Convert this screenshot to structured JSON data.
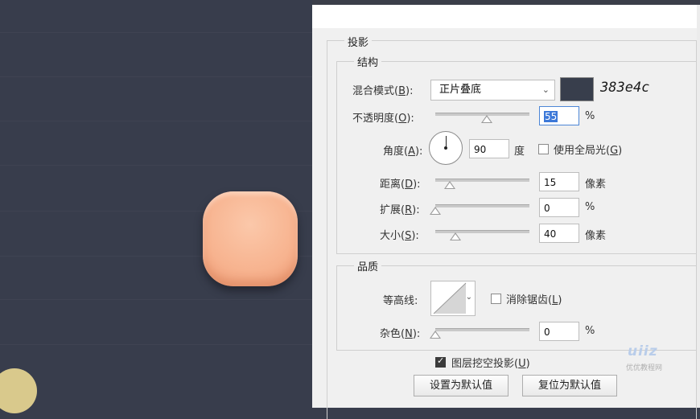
{
  "colors": {
    "canvas_bg": "#383d4c",
    "swatch": "#383e4c",
    "object_fill": "#f7b38f",
    "yellow_circle": "#d9c98c"
  },
  "dialog": {
    "section_title": "投影",
    "structure": {
      "title": "结构",
      "blend_mode": {
        "label_pre": "混合模式(",
        "key": "B",
        "label_post": "):",
        "value": "正片叠底",
        "swatch_hex": "383e4c"
      },
      "opacity": {
        "label_pre": "不透明度(",
        "key": "O",
        "label_post": "):",
        "value": "55",
        "unit": "%"
      },
      "angle": {
        "label_pre": "角度(",
        "key": "A",
        "label_post": "):",
        "value": "90",
        "unit": "度",
        "global_light_pre": "使用全局光(",
        "global_light_key": "G",
        "global_light_post": ")",
        "global_light_checked": false
      },
      "distance": {
        "label_pre": "距离(",
        "key": "D",
        "label_post": "):",
        "value": "15",
        "unit": "像素"
      },
      "spread": {
        "label_pre": "扩展(",
        "key": "R",
        "label_post": "):",
        "value": "0",
        "unit": "%"
      },
      "size": {
        "label_pre": "大小(",
        "key": "S",
        "label_post": "):",
        "value": "40",
        "unit": "像素"
      }
    },
    "quality": {
      "title": "品质",
      "contour": {
        "label": "等高线:",
        "anti_alias_pre": "消除锯齿(",
        "anti_alias_key": "L",
        "anti_alias_post": ")",
        "anti_alias_checked": false
      },
      "noise": {
        "label_pre": "杂色(",
        "key": "N",
        "label_post": "):",
        "value": "0",
        "unit": "%"
      }
    },
    "knockout": {
      "label_pre": "图层挖空投影(",
      "key": "U",
      "label_post": ")",
      "checked": true
    },
    "buttons": {
      "make_default": "设置为默认值",
      "reset_default": "复位为默认值"
    }
  },
  "watermark": {
    "logo": "uiiz",
    "text": "优优教程网"
  }
}
